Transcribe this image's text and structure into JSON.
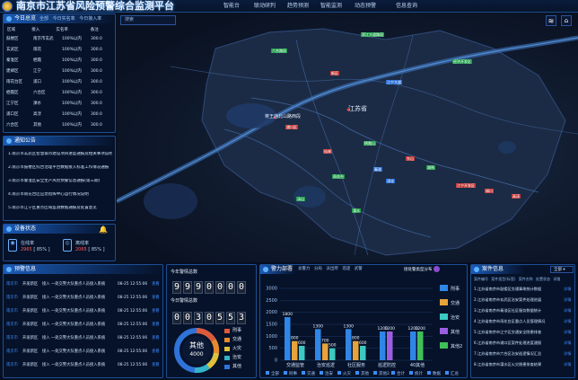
{
  "header": {
    "title": "南京市江苏省风险预警综合监测平台",
    "nav": [
      "智能台",
      "联动研判",
      "趋势预测",
      "智能监测",
      "动态预警",
      "信息查询"
    ]
  },
  "map": {
    "search_placeholder": "搜索",
    "province_label": "江苏省",
    "district_label": "蒋王庙北山路西段",
    "markers": [
      {
        "text": "滨江大道路段",
        "c": "mg"
      },
      {
        "text": "六合路段",
        "c": "mg"
      },
      {
        "text": "经济开发区",
        "c": "mg"
      },
      {
        "text": "新区",
        "c": "mr"
      },
      {
        "text": "江宁大道",
        "c": "mb"
      },
      {
        "text": "浦口区",
        "c": "mr"
      },
      {
        "text": "栖霞山",
        "c": "mg"
      },
      {
        "text": "仙林",
        "c": "mr"
      },
      {
        "text": "东山",
        "c": "mr"
      },
      {
        "text": "秦淮",
        "c": "mb"
      },
      {
        "text": "雨花台",
        "c": "mg"
      },
      {
        "text": "江宁开发区",
        "c": "mr"
      },
      {
        "text": "汤山",
        "c": "mg"
      },
      {
        "text": "禄口",
        "c": "mr"
      },
      {
        "text": "溧水",
        "c": "mg"
      },
      {
        "text": "高淳",
        "c": "mr"
      },
      {
        "text": "淳化",
        "c": "mb"
      },
      {
        "text": "湖熟",
        "c": "mg"
      }
    ]
  },
  "left_panel": {
    "title": "今日总览",
    "tabs": [
      "全部",
      "今日实名率",
      "今日接入率"
    ],
    "headers": [
      "区域",
      "接入",
      "实名率",
      "备注"
    ],
    "rows": [
      [
        "鼓楼区",
        "南京市玄武",
        "100%以内",
        "300.0"
      ],
      [
        "玄武区",
        "雨花",
        "100%以内",
        "300.0"
      ],
      [
        "秦淮区",
        "栖霞",
        "100%以内",
        "300.0"
      ],
      [
        "建邺区",
        "江宁",
        "100%以内",
        "300.0"
      ],
      [
        "雨花台区",
        "浦口",
        "100%以内",
        "300.0"
      ],
      [
        "栖霞区",
        "六合区",
        "100%以内",
        "300.0"
      ],
      [
        "江宁区",
        "溧水",
        "100%以内",
        "300.0"
      ],
      [
        "浦口区",
        "高淳",
        "100%以内",
        "300.0"
      ],
      [
        "六合区",
        "其他",
        "100%以内",
        "300.0"
      ]
    ]
  },
  "notice_panel": {
    "title": "通知公告",
    "items": [
      "1.南京市玄武区智慧城市建设项目进度通报及相关事项说明",
      "2.南京市鼓楼区综合治理平台数据接入标准工作情况通报",
      "3.南京市秦淮区安全生产风险预警信息通报(第三期)",
      "4.南京市雨花台区应急指挥中心运行情况说明",
      "5.南京市江宁区重点区域监测数据通报及处置意见"
    ]
  },
  "device_panel": {
    "title": "设备状态",
    "a_label": "在线率",
    "a_value": "2965",
    "a_pct": "[ 85% ]",
    "b_label": "离线率",
    "b_value": "2065",
    "b_pct": "[ 85% ]"
  },
  "alert_panel": {
    "title": "预警信息",
    "rows": [
      {
        "a": "南京市",
        "b": "开发新区",
        "c": "接入 一处交警大队重点人员接入系统",
        "d": "08-25 12:55:06",
        "e": "查看"
      },
      {
        "a": "南京市",
        "b": "开发新区",
        "c": "接入 一处交警大队重点人员接入系统",
        "d": "08-25 12:55:06",
        "e": "查看"
      },
      {
        "a": "南京市",
        "b": "开发新区",
        "c": "接入 一处交警大队重点人员接入系统",
        "d": "08-25 12:55:06",
        "e": "查看"
      },
      {
        "a": "南京市",
        "b": "开发新区",
        "c": "接入 一处交警大队重点人员接入系统",
        "d": "08-25 12:55:06",
        "e": "查看"
      },
      {
        "a": "南京市",
        "b": "开发新区",
        "c": "接入 一处交警大队重点人员接入系统",
        "d": "08-25 12:55:06",
        "e": "查看"
      },
      {
        "a": "南京市",
        "b": "开发新区",
        "c": "接入 一处交警大队重点人员接入系统",
        "d": "08-25 12:55:06",
        "e": "查看"
      },
      {
        "a": "南京市",
        "b": "开发新区",
        "c": "接入 一处交警大队重点人员接入系统",
        "d": "08-25 12:55:06",
        "e": "查看"
      }
    ]
  },
  "counter_panel": {
    "label1": "今年警情总数",
    "digits1": [
      "9",
      "9",
      "9",
      "0",
      "0",
      "0",
      "0"
    ],
    "label2": "今日警情总数",
    "digits2": [
      "0",
      "0",
      "3",
      "0",
      "5",
      "5",
      "3"
    ],
    "donut_center_label": "其他",
    "donut_center_value": "4000",
    "legend": [
      {
        "name": "刑事",
        "color": "#e05a3a"
      },
      {
        "name": "交通",
        "color": "#e98b2a"
      },
      {
        "name": "火灾",
        "color": "#e0c23a"
      },
      {
        "name": "治安",
        "color": "#34b3c9"
      },
      {
        "name": "其他",
        "color": "#2f73d8"
      }
    ]
  },
  "bar_panel": {
    "title": "警力部署",
    "tabs": [
      "总警力",
      "分局",
      "派出所",
      "巡逻",
      "武警"
    ],
    "badge": "接处警类型分布"
  },
  "chart_data": {
    "type": "bar",
    "categories": [
      "交通监管",
      "治安巡逻",
      "社区服务",
      "巡逻防控",
      "40其他"
    ],
    "ylim": [
      0,
      3000
    ],
    "yticks": [
      0,
      500,
      1000,
      1500,
      2000,
      2500,
      3000
    ],
    "series": [
      {
        "name": "刑事",
        "color": "#2f86e6",
        "values": [
          1800,
          1300,
          1300,
          1200,
          1200
        ]
      },
      {
        "name": "交通",
        "color": "#e7a33a",
        "values": [
          800,
          700,
          800,
          0,
          0
        ]
      },
      {
        "name": "治安",
        "color": "#3bc9c2",
        "values": [
          600,
          500,
          600,
          0,
          0
        ]
      },
      {
        "name": "其他",
        "color": "#9b5ee0",
        "values": [
          0,
          0,
          0,
          1200,
          0
        ]
      },
      {
        "name": "其他2",
        "color": "#3fbf5a",
        "values": [
          0,
          0,
          0,
          0,
          1200
        ]
      }
    ],
    "legend": [
      "刑事",
      "交通",
      "治安",
      "其他",
      "其他2"
    ],
    "bottom_legend": [
      "全部",
      "刑事",
      "交通",
      "治安",
      "火灾",
      "其他",
      "其他2",
      "合计",
      "统计",
      "数据",
      "汇总"
    ]
  },
  "case_panel": {
    "title": "案件信息",
    "select_value": "全部",
    "headers": [
      "案件编号",
      "案件类型(标签)",
      "案件名称",
      "处置状态",
      "详细"
    ],
    "rows": [
      {
        "text": "1.江苏省南京市鼓楼区交通事故统计数据",
        "link": "详情"
      },
      {
        "text": "2.江苏省南京市玄武区治安案件处理进展",
        "link": "详情"
      },
      {
        "text": "3.江苏省南京市秦淮区社区服务数据统计",
        "link": "详情"
      },
      {
        "text": "4.江苏省南京市雨花台区重点人员管理情况",
        "link": "详情"
      },
      {
        "text": "5.江苏省南京市江宁区交通安全隐患排查",
        "link": "详情"
      },
      {
        "text": "6.江苏省南京市浦口区案件处理进度通报",
        "link": "详情"
      },
      {
        "text": "7.江苏省南京市六合区治安巡逻情况汇总",
        "link": "详情"
      },
      {
        "text": "8.江苏省南京市溧水区火灾隐患排查结果",
        "link": "详情"
      }
    ]
  }
}
